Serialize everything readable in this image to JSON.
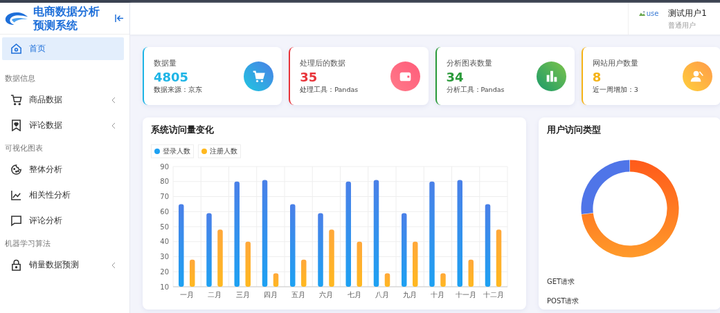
{
  "brand": {
    "title": "电商数据分析预测系统"
  },
  "sidebar": {
    "sections": [
      {
        "items": [
          {
            "label": "首页",
            "selected": true,
            "expandable": false
          }
        ]
      },
      {
        "heading": "数据信息",
        "items": [
          {
            "label": "商品数据",
            "selected": false,
            "expandable": true
          },
          {
            "label": "评论数据",
            "selected": false,
            "expandable": true
          }
        ]
      },
      {
        "heading": "可视化图表",
        "items": [
          {
            "label": "整体分析",
            "selected": false,
            "expandable": false
          },
          {
            "label": "相关性分析",
            "selected": false,
            "expandable": false
          },
          {
            "label": "评论分析",
            "selected": false,
            "expandable": false
          }
        ]
      },
      {
        "heading": "机器学习算法",
        "items": [
          {
            "label": "销量数据预测",
            "selected": false,
            "expandable": true
          }
        ]
      }
    ]
  },
  "user": {
    "avatar_alt": "use",
    "name": "测试用户1",
    "role": "普通用户"
  },
  "stats": [
    {
      "title": "数据量",
      "value": "4805",
      "note": "数据来源：京东",
      "color": "#1fb5e6"
    },
    {
      "title": "处理后的数据",
      "value": "35",
      "note": "处理工具：Pandas",
      "color": "#e8343a"
    },
    {
      "title": "分析图表数量",
      "value": "34",
      "note": "分析工具：Pandas",
      "color": "#2a9a3a"
    },
    {
      "title": "网站用户数量",
      "value": "8",
      "note": "近一周增加：3",
      "color": "#f5b316"
    }
  ],
  "visits": {
    "title": "系统访问量变化",
    "chart_data": {
      "type": "bar",
      "categories": [
        "一月",
        "二月",
        "三月",
        "四月",
        "五月",
        "六月",
        "七月",
        "八月",
        "九月",
        "十月",
        "十一月",
        "十二月"
      ],
      "series": [
        {
          "name": "登录人数",
          "color": "#1da1f2",
          "values": [
            65,
            59,
            80,
            81,
            65,
            59,
            80,
            81,
            59,
            80,
            81,
            65
          ]
        },
        {
          "name": "注册人数",
          "color": "#ffb81f",
          "values": [
            28,
            48,
            40,
            19,
            28,
            48,
            40,
            19,
            40,
            19,
            28,
            48
          ]
        }
      ],
      "grid": true,
      "ylim": [
        10,
        90
      ],
      "yticks": [
        10,
        20,
        30,
        40,
        50,
        60,
        70,
        80,
        90
      ]
    }
  },
  "access": {
    "title": "用户访问类型",
    "legend": [
      "GET请求",
      "POST请求"
    ]
  }
}
